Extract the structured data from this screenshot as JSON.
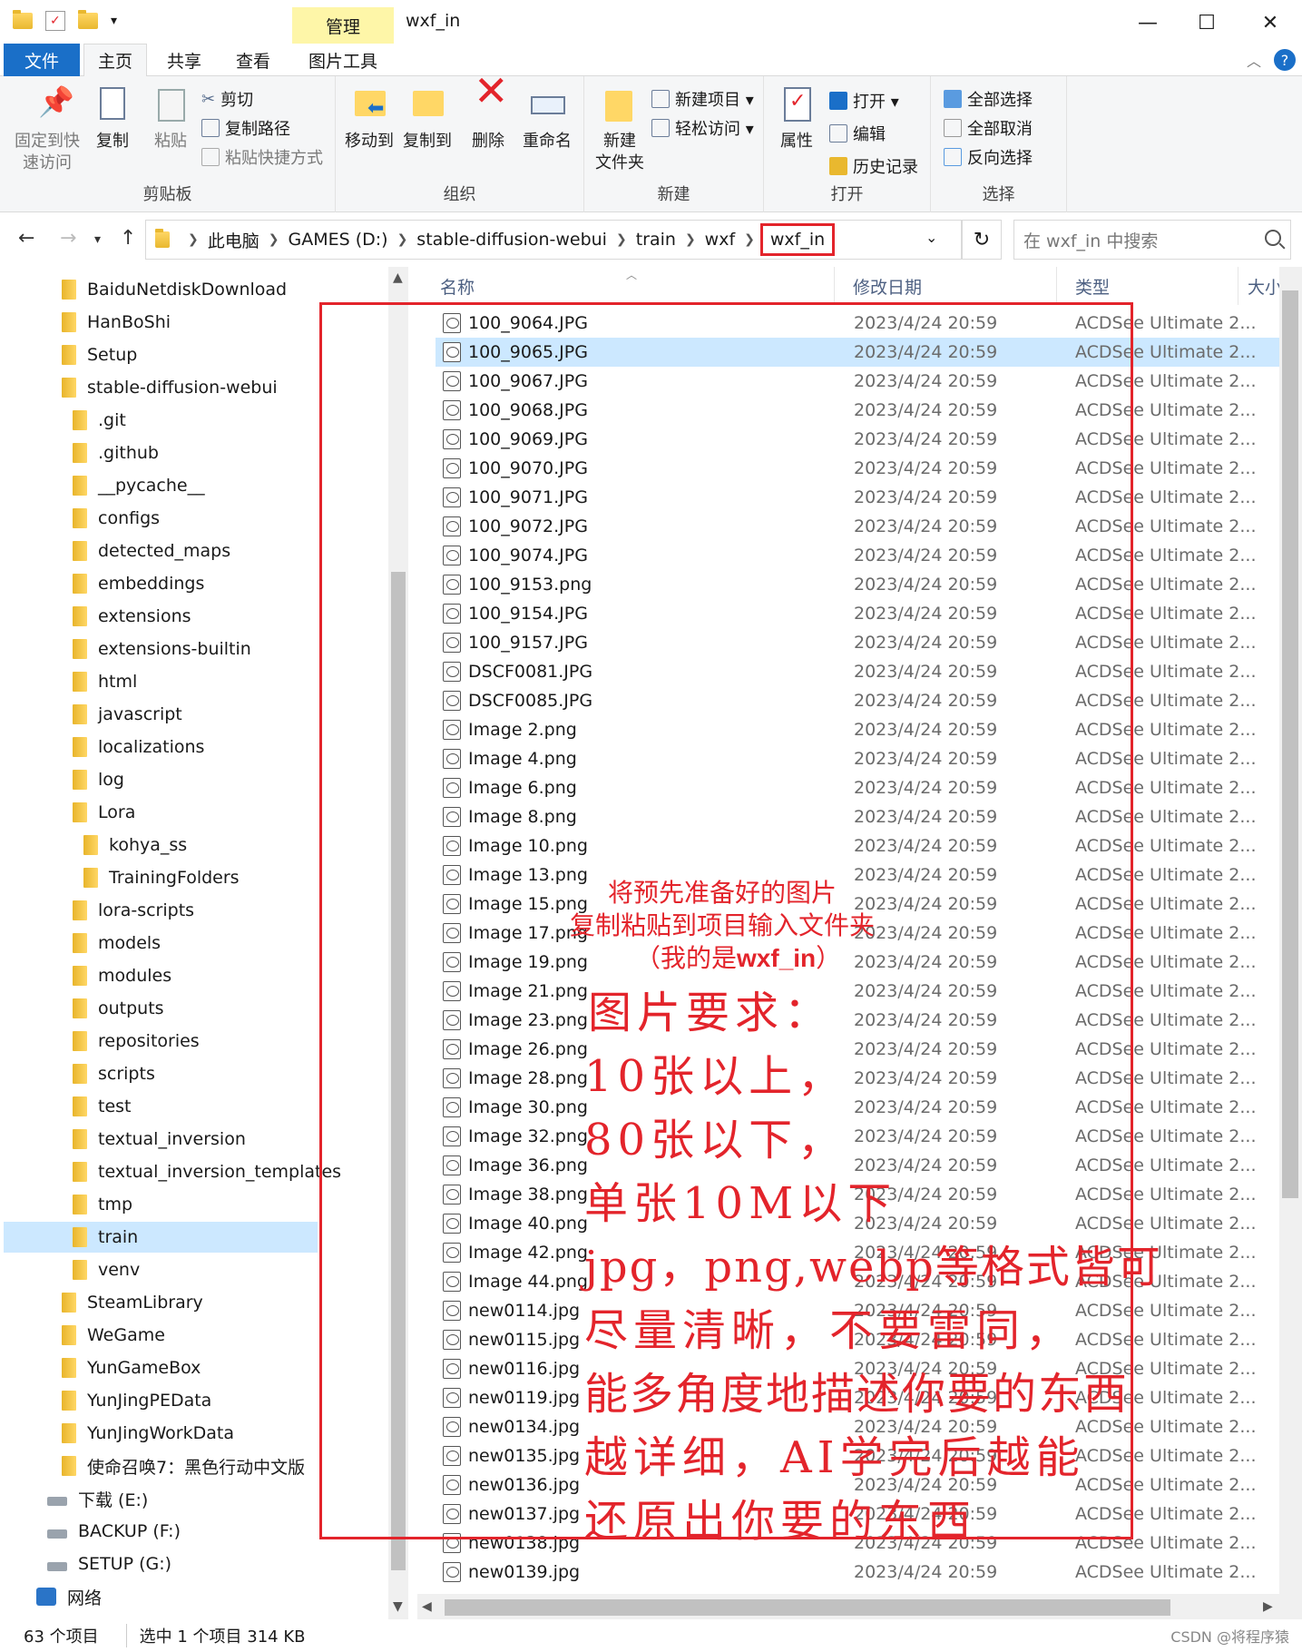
{
  "window": {
    "title": "wxf_in",
    "manage_tab": "管理",
    "minimize": "—",
    "maximize": "☐",
    "close": "✕"
  },
  "ribbon_tabs": {
    "file": "文件",
    "home": "主页",
    "share": "共享",
    "view": "查看",
    "picture_tools": "图片工具"
  },
  "ribbon": {
    "clipboard": {
      "label": "剪贴板",
      "pin": "固定到快\n速访问",
      "copy": "复制",
      "paste": "粘贴",
      "cut": "剪切",
      "copy_path": "复制路径",
      "paste_shortcut": "粘贴快捷方式"
    },
    "organize": {
      "label": "组织",
      "move_to": "移动到",
      "copy_to": "复制到",
      "delete": "删除",
      "rename": "重命名"
    },
    "new": {
      "label": "新建",
      "new_folder": "新建\n文件夹",
      "new_item": "新建项目 ▾",
      "easy_access": "轻松访问 ▾"
    },
    "open": {
      "label": "打开",
      "properties": "属性",
      "open": "打开 ▾",
      "edit": "编辑",
      "history": "历史记录"
    },
    "select": {
      "label": "选择",
      "select_all": "全部选择",
      "select_none": "全部取消",
      "invert": "反向选择"
    }
  },
  "address": {
    "crumbs": [
      "此电脑",
      "GAMES (D:)",
      "stable-diffusion-webui",
      "train",
      "wxf"
    ],
    "current": "wxf_in",
    "search_placeholder": "在 wxf_in 中搜索"
  },
  "nav_tree": [
    {
      "label": "BaiduNetdiskDownload",
      "indent": 1
    },
    {
      "label": "HanBoShi",
      "indent": 1
    },
    {
      "label": "Setup",
      "indent": 1
    },
    {
      "label": "stable-diffusion-webui",
      "indent": 1
    },
    {
      "label": ".git",
      "indent": 2
    },
    {
      "label": ".github",
      "indent": 2
    },
    {
      "label": "__pycache__",
      "indent": 2
    },
    {
      "label": "configs",
      "indent": 2
    },
    {
      "label": "detected_maps",
      "indent": 2
    },
    {
      "label": "embeddings",
      "indent": 2
    },
    {
      "label": "extensions",
      "indent": 2
    },
    {
      "label": "extensions-builtin",
      "indent": 2
    },
    {
      "label": "html",
      "indent": 2
    },
    {
      "label": "javascript",
      "indent": 2
    },
    {
      "label": "localizations",
      "indent": 2
    },
    {
      "label": "log",
      "indent": 2
    },
    {
      "label": "Lora",
      "indent": 2
    },
    {
      "label": "kohya_ss",
      "indent": 3
    },
    {
      "label": "TrainingFolders",
      "indent": 3
    },
    {
      "label": "lora-scripts",
      "indent": 2
    },
    {
      "label": "models",
      "indent": 2
    },
    {
      "label": "modules",
      "indent": 2
    },
    {
      "label": "outputs",
      "indent": 2
    },
    {
      "label": "repositories",
      "indent": 2
    },
    {
      "label": "scripts",
      "indent": 2
    },
    {
      "label": "test",
      "indent": 2
    },
    {
      "label": "textual_inversion",
      "indent": 2
    },
    {
      "label": "textual_inversion_templates",
      "indent": 2
    },
    {
      "label": "tmp",
      "indent": 2
    },
    {
      "label": "train",
      "indent": 2,
      "selected": true
    },
    {
      "label": "venv",
      "indent": 2
    },
    {
      "label": "SteamLibrary",
      "indent": 1
    },
    {
      "label": "WeGame",
      "indent": 1
    },
    {
      "label": "YunGameBox",
      "indent": 1
    },
    {
      "label": "YunJingPEData",
      "indent": 1
    },
    {
      "label": "YunJingWorkData",
      "indent": 1
    },
    {
      "label": "使命召唤7：黑色行动中文版",
      "indent": 1
    },
    {
      "label": "下载 (E:)",
      "indent": 0,
      "drive": true
    },
    {
      "label": "BACKUP (F:)",
      "indent": 0,
      "drive": true
    },
    {
      "label": "SETUP (G:)",
      "indent": 0,
      "drive": true
    },
    {
      "label": "网络",
      "indent": -1,
      "network": true
    }
  ],
  "columns": {
    "name": "名称",
    "date": "修改日期",
    "type": "类型",
    "size": "大小"
  },
  "files": [
    {
      "name": "100_9064.JPG",
      "date": "2023/4/24 20:59",
      "type": "ACDSee Ultimate 2..."
    },
    {
      "name": "100_9065.JPG",
      "date": "2023/4/24 20:59",
      "type": "ACDSee Ultimate 2...",
      "selected": true
    },
    {
      "name": "100_9067.JPG",
      "date": "2023/4/24 20:59",
      "type": "ACDSee Ultimate 2..."
    },
    {
      "name": "100_9068.JPG",
      "date": "2023/4/24 20:59",
      "type": "ACDSee Ultimate 2..."
    },
    {
      "name": "100_9069.JPG",
      "date": "2023/4/24 20:59",
      "type": "ACDSee Ultimate 2..."
    },
    {
      "name": "100_9070.JPG",
      "date": "2023/4/24 20:59",
      "type": "ACDSee Ultimate 2..."
    },
    {
      "name": "100_9071.JPG",
      "date": "2023/4/24 20:59",
      "type": "ACDSee Ultimate 2..."
    },
    {
      "name": "100_9072.JPG",
      "date": "2023/4/24 20:59",
      "type": "ACDSee Ultimate 2..."
    },
    {
      "name": "100_9074.JPG",
      "date": "2023/4/24 20:59",
      "type": "ACDSee Ultimate 2..."
    },
    {
      "name": "100_9153.png",
      "date": "2023/4/24 20:59",
      "type": "ACDSee Ultimate 2..."
    },
    {
      "name": "100_9154.JPG",
      "date": "2023/4/24 20:59",
      "type": "ACDSee Ultimate 2..."
    },
    {
      "name": "100_9157.JPG",
      "date": "2023/4/24 20:59",
      "type": "ACDSee Ultimate 2..."
    },
    {
      "name": "DSCF0081.JPG",
      "date": "2023/4/24 20:59",
      "type": "ACDSee Ultimate 2..."
    },
    {
      "name": "DSCF0085.JPG",
      "date": "2023/4/24 20:59",
      "type": "ACDSee Ultimate 2..."
    },
    {
      "name": "Image 2.png",
      "date": "2023/4/24 20:59",
      "type": "ACDSee Ultimate 2..."
    },
    {
      "name": "Image 4.png",
      "date": "2023/4/24 20:59",
      "type": "ACDSee Ultimate 2..."
    },
    {
      "name": "Image 6.png",
      "date": "2023/4/24 20:59",
      "type": "ACDSee Ultimate 2..."
    },
    {
      "name": "Image 8.png",
      "date": "2023/4/24 20:59",
      "type": "ACDSee Ultimate 2..."
    },
    {
      "name": "Image 10.png",
      "date": "2023/4/24 20:59",
      "type": "ACDSee Ultimate 2..."
    },
    {
      "name": "Image 13.png",
      "date": "2023/4/24 20:59",
      "type": "ACDSee Ultimate 2..."
    },
    {
      "name": "Image 15.png",
      "date": "2023/4/24 20:59",
      "type": "ACDSee Ultimate 2..."
    },
    {
      "name": "Image 17.png",
      "date": "2023/4/24 20:59",
      "type": "ACDSee Ultimate 2..."
    },
    {
      "name": "Image 19.png",
      "date": "2023/4/24 20:59",
      "type": "ACDSee Ultimate 2..."
    },
    {
      "name": "Image 21.png",
      "date": "2023/4/24 20:59",
      "type": "ACDSee Ultimate 2..."
    },
    {
      "name": "Image 23.png",
      "date": "2023/4/24 20:59",
      "type": "ACDSee Ultimate 2..."
    },
    {
      "name": "Image 26.png",
      "date": "2023/4/24 20:59",
      "type": "ACDSee Ultimate 2..."
    },
    {
      "name": "Image 28.png",
      "date": "2023/4/24 20:59",
      "type": "ACDSee Ultimate 2..."
    },
    {
      "name": "Image 30.png",
      "date": "2023/4/24 20:59",
      "type": "ACDSee Ultimate 2..."
    },
    {
      "name": "Image 32.png",
      "date": "2023/4/24 20:59",
      "type": "ACDSee Ultimate 2..."
    },
    {
      "name": "Image 36.png",
      "date": "2023/4/24 20:59",
      "type": "ACDSee Ultimate 2..."
    },
    {
      "name": "Image 38.png",
      "date": "2023/4/24 20:59",
      "type": "ACDSee Ultimate 2..."
    },
    {
      "name": "Image 40.png",
      "date": "2023/4/24 20:59",
      "type": "ACDSee Ultimate 2..."
    },
    {
      "name": "Image 42.png",
      "date": "2023/4/24 20:59",
      "type": "ACDSee Ultimate 2..."
    },
    {
      "name": "Image 44.png",
      "date": "2023/4/24 20:59",
      "type": "ACDSee Ultimate 2..."
    },
    {
      "name": "new0114.jpg",
      "date": "2023/4/24 20:59",
      "type": "ACDSee Ultimate 2..."
    },
    {
      "name": "new0115.jpg",
      "date": "2023/4/24 20:59",
      "type": "ACDSee Ultimate 2..."
    },
    {
      "name": "new0116.jpg",
      "date": "2023/4/24 20:59",
      "type": "ACDSee Ultimate 2..."
    },
    {
      "name": "new0119.jpg",
      "date": "2023/4/24 20:59",
      "type": "ACDSee Ultimate 2..."
    },
    {
      "name": "new0134.jpg",
      "date": "2023/4/24 20:59",
      "type": "ACDSee Ultimate 2..."
    },
    {
      "name": "new0135.jpg",
      "date": "2023/4/24 20:59",
      "type": "ACDSee Ultimate 2..."
    },
    {
      "name": "new0136.jpg",
      "date": "2023/4/24 20:59",
      "type": "ACDSee Ultimate 2..."
    },
    {
      "name": "new0137.jpg",
      "date": "2023/4/24 20:59",
      "type": "ACDSee Ultimate 2..."
    },
    {
      "name": "new0138.jpg",
      "date": "2023/4/24 20:59",
      "type": "ACDSee Ultimate 2..."
    },
    {
      "name": "new0139.jpg",
      "date": "2023/4/24 20:59",
      "type": "ACDSee Ultimate 2..."
    }
  ],
  "status": {
    "count": "63 个项目",
    "selected": "选中 1 个项目  314 KB"
  },
  "annotation": {
    "line1": "将预先准备好的图片",
    "line2": "复制粘贴到项目输入文件夹",
    "line3_prefix": "（我的是",
    "line3_bold": "wxf_in",
    "line3_suffix": "）",
    "req_title": "图片要求：",
    "req1": "10张以上，",
    "req2": "80张以下，",
    "req3": "单张10M以下",
    "req4": "jpg，png,webp等格式皆可",
    "req5": "尽量清晰，不要雷同，",
    "req6": "能多角度地描述你要的东西",
    "req7": "越详细，AI学完后越能",
    "req8": "还原出你要的东西",
    "color": "#e3242b"
  },
  "watermark": "CSDN @将程序猿"
}
